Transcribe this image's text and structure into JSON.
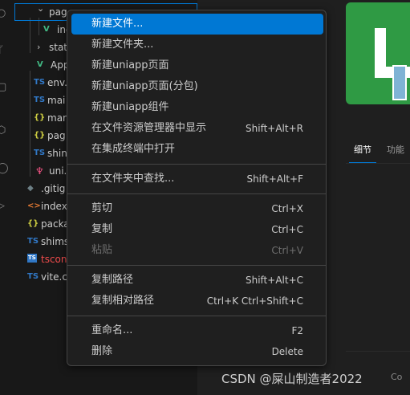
{
  "explorer": {
    "rows": [
      {
        "name": "pages/index",
        "icon": "chevron-down",
        "label": "",
        "text": "pag"
      },
      {
        "name": "index.vue",
        "icon": "vue-icon",
        "label": "V",
        "text": "ind"
      },
      {
        "name": "static",
        "icon": "chevron-right",
        "label": "",
        "text": "stat"
      },
      {
        "name": "App.vue",
        "icon": "vue-icon",
        "label": "V",
        "text": "App"
      },
      {
        "name": "env.d.ts",
        "icon": "ts-icon",
        "label": "TS",
        "text": "env."
      },
      {
        "name": "main.ts",
        "icon": "ts-icon",
        "label": "TS",
        "text": "mai"
      },
      {
        "name": "manifest.json",
        "icon": "json-icon",
        "label": "{}",
        "text": "mar"
      },
      {
        "name": "pages.json",
        "icon": "json-icon",
        "label": "{}",
        "text": "pag"
      },
      {
        "name": "shime.d.ts",
        "icon": "ts-icon",
        "label": "TS",
        "text": "shin"
      },
      {
        "name": "uni.scss",
        "icon": "scss-icon",
        "label": "",
        "text": "uni."
      },
      {
        "name": ".gitignore",
        "icon": "git-icon",
        "label": "◆",
        "text": ".gitig"
      },
      {
        "name": "index.html",
        "icon": "html-icon",
        "label": "<>",
        "text": "index"
      },
      {
        "name": "package.json",
        "icon": "json-icon",
        "label": "{}",
        "text": "packa"
      },
      {
        "name": "shims-uni.d.ts",
        "icon": "ts-icon",
        "label": "TS",
        "text": "shims"
      },
      {
        "name": "tsconfig.json",
        "icon": "tsconfig-icon",
        "label": "TS",
        "text": "tscon"
      },
      {
        "name": "vite.config.ts",
        "icon": "ts-icon",
        "label": "TS",
        "text": "vite.c"
      }
    ]
  },
  "context_menu": {
    "groups": [
      [
        {
          "label": "新建文件...",
          "shortcut": "",
          "state": "active"
        },
        {
          "label": "新建文件夹...",
          "shortcut": "",
          "state": "normal"
        },
        {
          "label": "新建uniapp页面",
          "shortcut": "",
          "state": "normal"
        },
        {
          "label": "新建uniapp页面(分包)",
          "shortcut": "",
          "state": "normal"
        },
        {
          "label": "新建uniapp组件",
          "shortcut": "",
          "state": "normal"
        },
        {
          "label": "在文件资源管理器中显示",
          "shortcut": "Shift+Alt+R",
          "state": "normal"
        },
        {
          "label": "在集成终端中打开",
          "shortcut": "",
          "state": "normal"
        }
      ],
      [
        {
          "label": "在文件夹中查找...",
          "shortcut": "Shift+Alt+F",
          "state": "normal"
        }
      ],
      [
        {
          "label": "剪切",
          "shortcut": "Ctrl+X",
          "state": "normal"
        },
        {
          "label": "复制",
          "shortcut": "Ctrl+C",
          "state": "normal"
        },
        {
          "label": "粘贴",
          "shortcut": "Ctrl+V",
          "state": "disabled"
        }
      ],
      [
        {
          "label": "复制路径",
          "shortcut": "Shift+Alt+C",
          "state": "normal"
        },
        {
          "label": "复制相对路径",
          "shortcut": "Ctrl+K Ctrl+Shift+C",
          "state": "normal"
        }
      ],
      [
        {
          "label": "重命名...",
          "shortcut": "F2",
          "state": "normal"
        },
        {
          "label": "删除",
          "shortcut": "Delete",
          "state": "normal"
        }
      ]
    ]
  },
  "details": {
    "tabs": [
      "细节",
      "功能"
    ]
  },
  "watermark": "CSDN @屎山制造者2022",
  "edge_text": "Co",
  "colors": {
    "accent": "#0078d4",
    "vue": "#41b883",
    "ts": "#3178c6",
    "json": "#cbcb41",
    "logo_green": "#2f9a44"
  }
}
